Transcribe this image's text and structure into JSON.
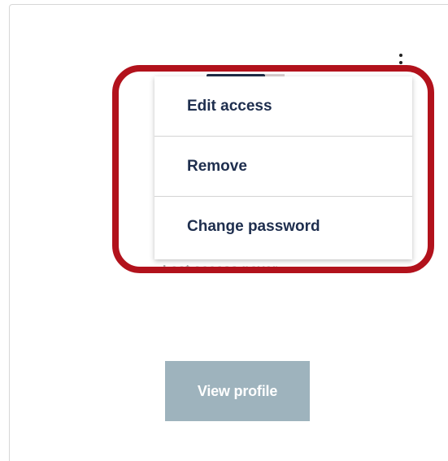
{
  "menu": {
    "items": [
      {
        "label": "Edit access"
      },
      {
        "label": "Remove"
      },
      {
        "label": "Change password"
      }
    ]
  },
  "card": {
    "last_access_text": "Last access never",
    "view_profile_label": "View profile",
    "more_icon": "kebab-vertical-icon"
  },
  "colors": {
    "highlight": "#b2121c",
    "menu_text": "#1e2e4e",
    "button_bg": "#9eb3bd"
  }
}
